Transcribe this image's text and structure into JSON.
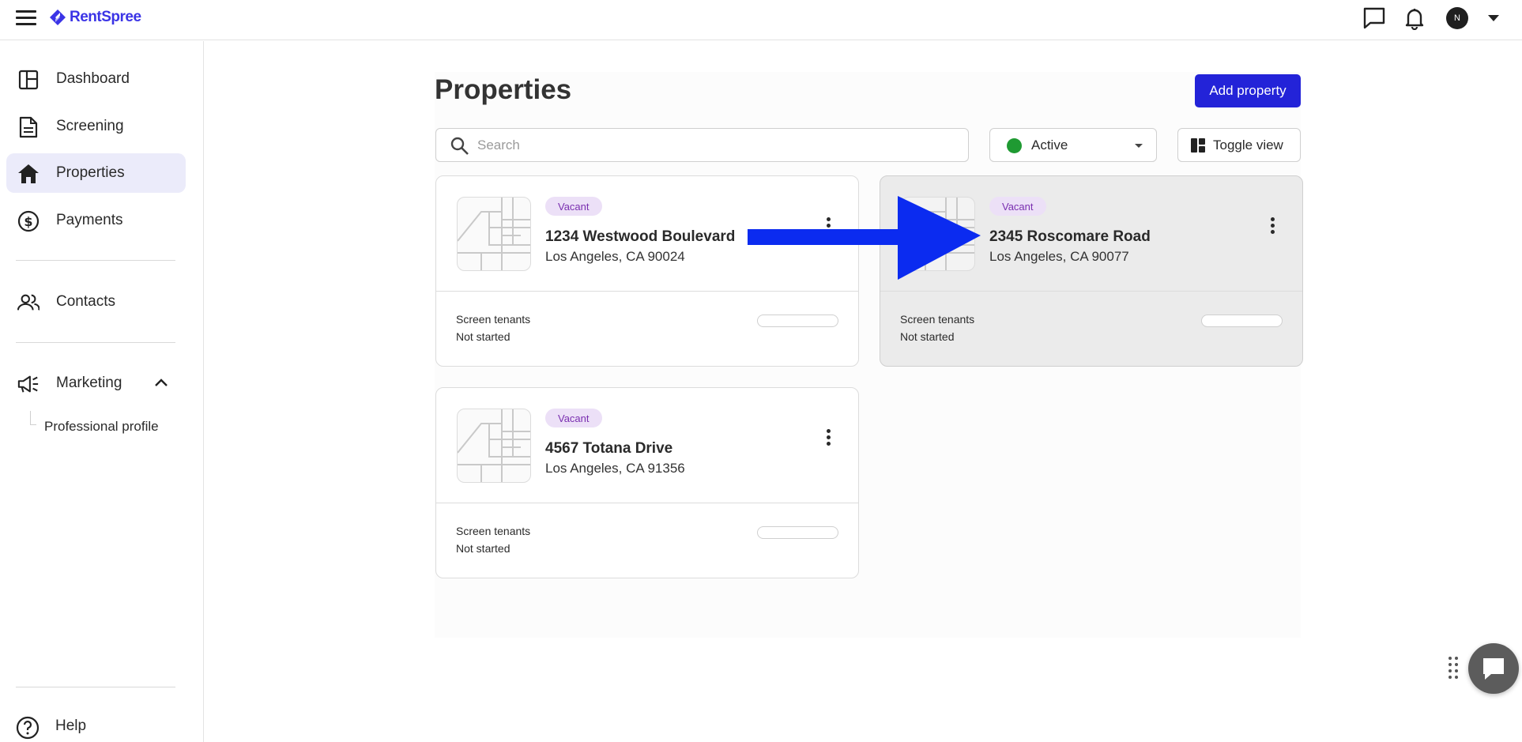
{
  "app": {
    "brand": "RentSpree",
    "brand_color": "#3b34e6",
    "accent_color": "#2323d8",
    "user_initial": "N"
  },
  "sidebar": {
    "items": [
      {
        "label": "Dashboard",
        "icon": "dashboard-icon"
      },
      {
        "label": "Screening",
        "icon": "document-icon"
      },
      {
        "label": "Properties",
        "icon": "home-icon",
        "active": true
      },
      {
        "label": "Payments",
        "icon": "dollar-circle-icon"
      },
      {
        "label": "Contacts",
        "icon": "people-icon"
      },
      {
        "label": "Marketing",
        "icon": "megaphone-icon",
        "expanded": true
      }
    ],
    "marketing_sub": "Professional profile",
    "help": "Help"
  },
  "main": {
    "title": "Properties",
    "add_button": "Add property",
    "search_placeholder": "Search",
    "status_filter": "Active",
    "status_color": "#1f9a32",
    "toggle_view": "Toggle view"
  },
  "properties": [
    {
      "badge": "Vacant",
      "address": "1234 Westwood Boulevard",
      "city": "Los Angeles, CA 90024",
      "screen_label": "Screen tenants",
      "screen_status": "Not started",
      "progress": 0
    },
    {
      "badge": "Vacant",
      "address": "2345 Roscomare Road",
      "city": "Los Angeles, CA 90077",
      "screen_label": "Screen tenants",
      "screen_status": "Not started",
      "progress": 0
    },
    {
      "badge": "Vacant",
      "address": "4567 Totana Drive",
      "city": "Los Angeles, CA 91356",
      "screen_label": "Screen tenants",
      "screen_status": "Not started",
      "progress": 0
    }
  ],
  "annotation": {
    "arrow_color": "#0b2bf0"
  }
}
